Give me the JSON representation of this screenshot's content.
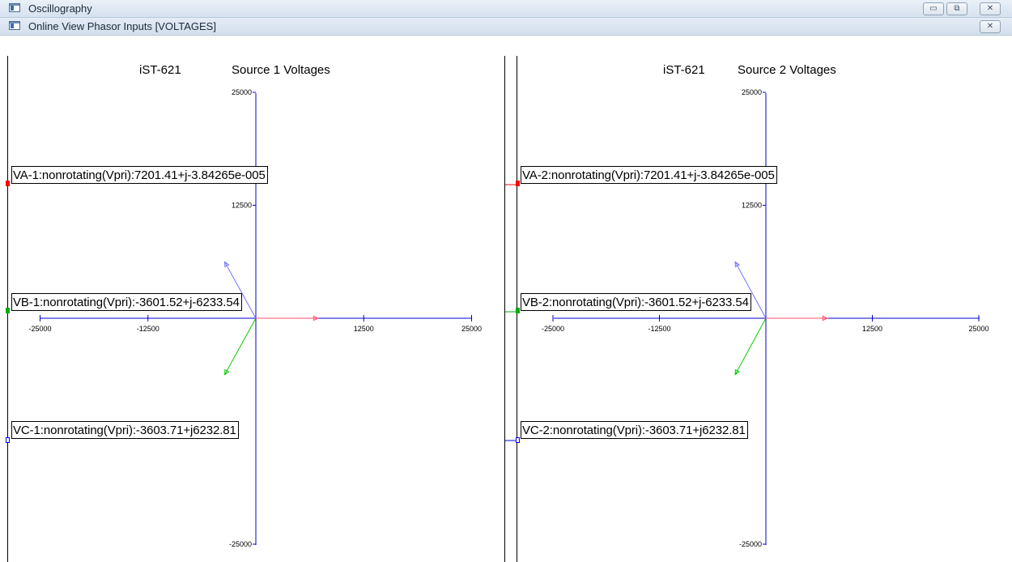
{
  "window": {
    "title": "Oscillography",
    "buttons": {
      "minimize": "▭",
      "restore": "⧉",
      "close": "✕"
    }
  },
  "child_window": {
    "title": "Online View Phasor Inputs [VOLTAGES]",
    "close": "✕"
  },
  "panels": [
    {
      "device": "iST-621",
      "title": "Source 1 Voltages",
      "labels": [
        "VA-1:nonrotating(Vpri):7201.41+j-3.84265e-005",
        "VB-1:nonrotating(Vpri):-3601.52+j-6233.54",
        "VC-1:nonrotating(Vpri):-3603.71+j6232.81"
      ],
      "ticks": {
        "x": [
          "-25000",
          "-12500",
          "12500",
          "25000"
        ],
        "y_top": "25000",
        "y_mid": "12500",
        "y_bottom": "-25000"
      }
    },
    {
      "device": "iST-621",
      "title": "Source 2 Voltages",
      "labels": [
        "VA-2:nonrotating(Vpri):7201.41+j-3.84265e-005",
        "VB-2:nonrotating(Vpri):-3601.52+j-6233.54",
        "VC-2:nonrotating(Vpri):-3603.71+j6232.81"
      ],
      "ticks": {
        "x": [
          "-25000",
          "-12500",
          "12500",
          "25000"
        ],
        "y_top": "25000",
        "y_mid": "12500",
        "y_bottom": "-25000"
      }
    }
  ],
  "chart_data": [
    {
      "type": "scatter",
      "title": "Source 1 Voltages",
      "xlim": [
        -25000,
        25000
      ],
      "ylim": [
        -25000,
        25000
      ],
      "series": [
        {
          "name": "VA-1",
          "x": 7201.41,
          "y": -3.84265e-05,
          "color": "#ff4d6d"
        },
        {
          "name": "VB-1",
          "x": -3601.52,
          "y": -6233.54,
          "color": "#00cc00"
        },
        {
          "name": "VC-1",
          "x": -3603.71,
          "y": 6232.81,
          "color": "#7070ff"
        }
      ]
    },
    {
      "type": "scatter",
      "title": "Source 2 Voltages",
      "xlim": [
        -25000,
        25000
      ],
      "ylim": [
        -25000,
        25000
      ],
      "series": [
        {
          "name": "VA-2",
          "x": 7201.41,
          "y": -3.84265e-05,
          "color": "#ff4d6d"
        },
        {
          "name": "VB-2",
          "x": -3601.52,
          "y": -6233.54,
          "color": "#00cc00"
        },
        {
          "name": "VC-2",
          "x": -3603.71,
          "y": 6232.81,
          "color": "#7070ff"
        }
      ]
    }
  ],
  "colors": {
    "axis": "#0000cc",
    "phase_a": "#ff0000",
    "phase_b": "#00aa00",
    "phase_c": "#0000ff"
  }
}
